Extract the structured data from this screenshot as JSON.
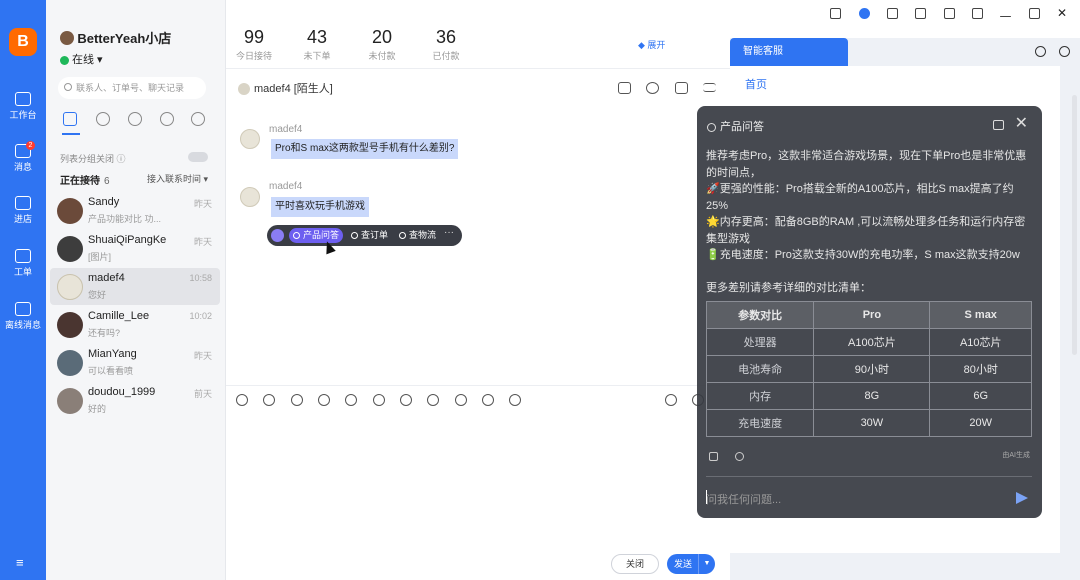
{
  "rail": {
    "logo": "B",
    "items": [
      {
        "label": "工作台",
        "icon": "dashboard-icon"
      },
      {
        "label": "消息",
        "icon": "message-icon",
        "badge": "2"
      },
      {
        "label": "进店",
        "icon": "store-icon"
      },
      {
        "label": "工单",
        "icon": "ticket-icon"
      },
      {
        "label": "离线消息",
        "icon": "offline-message-icon"
      }
    ],
    "menu": "≡"
  },
  "store": {
    "name": "BetterYeah小店",
    "status": "在线"
  },
  "search": {
    "placeholder": "联系人、订单号、聊天记录"
  },
  "sidebar": {
    "group_text": "列表分组关闭",
    "section_title": "正在接待",
    "section_count": "6",
    "sort_label": "接入联系时间 ▾",
    "contacts": [
      {
        "name": "Sandy",
        "preview": "产品功能对比 功...",
        "time": "昨天"
      },
      {
        "name": "ShuaiQiPangKe",
        "preview": "[图片]",
        "time": "昨天"
      },
      {
        "name": "madef4",
        "preview": "您好",
        "time": "10:58"
      },
      {
        "name": "Camille_Lee",
        "preview": "还有吗?",
        "time": "10:02"
      },
      {
        "name": "MianYang",
        "preview": "可以看看喷",
        "time": "昨天"
      },
      {
        "name": "doudou_1999",
        "preview": "好的",
        "time": "前天"
      }
    ]
  },
  "stats": [
    {
      "value": "99",
      "label": "今日接待"
    },
    {
      "value": "43",
      "label": "未下单"
    },
    {
      "value": "20",
      "label": "未付款"
    },
    {
      "value": "36",
      "label": "已付款"
    }
  ],
  "expand_label": "展开",
  "chat": {
    "header": "madef4 [陌生人]",
    "messages": [
      {
        "sender": "madef4",
        "text": "Pro和S max这两款型号手机有什么差别?"
      },
      {
        "sender": "madef4",
        "text": "平时喜欢玩手机游戏"
      }
    ],
    "floating_actions": [
      "产品问答",
      "查订单",
      "查物流",
      "···"
    ],
    "close_button": "关闭",
    "send_button": "发送"
  },
  "right_panel": {
    "tab": "智能客服",
    "home": "首页"
  },
  "overlay": {
    "title": "产品问答",
    "paragraphs": [
      "推荐考虑Pro，这款非常适合游戏场景，现在下单Pro也是非常优惠的时间点，",
      "🚀更强的性能：Pro搭载全新的A100芯片，相比S max提高了约25%",
      "🌟内存更高：配备8GB的RAM ,可以流畅处理多任务和运行内存密集型游戏",
      "🔋充电速度：Pro这款支持30W的充电功率，S max这款支持20w"
    ],
    "more_text": "更多差别请参考详细的对比清单：",
    "table": {
      "headers": [
        "参数对比",
        "Pro",
        "S max"
      ],
      "rows": [
        [
          "处理器",
          "A100芯片",
          "A10芯片"
        ],
        [
          "电池寿命",
          "90小时",
          "80小时"
        ],
        [
          "内存",
          "8G",
          "6G"
        ],
        [
          "充电速度",
          "30W",
          "20W"
        ]
      ]
    },
    "ai_note": "由AI生成",
    "input_placeholder": "问我任何问题..."
  }
}
